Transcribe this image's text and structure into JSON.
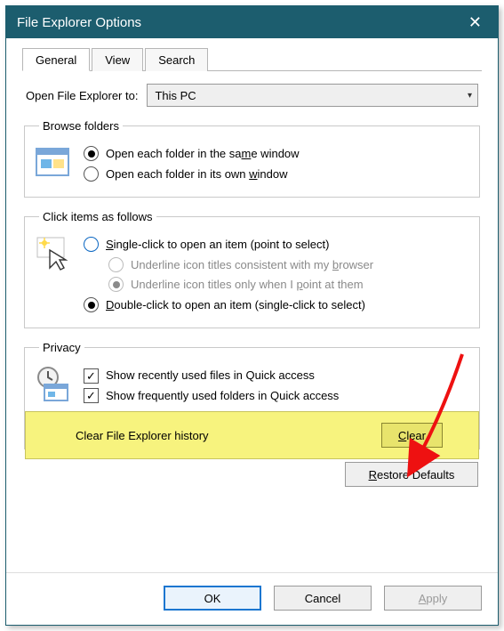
{
  "titlebar": {
    "title": "File Explorer Options"
  },
  "tabs": {
    "general": "General",
    "view": "View",
    "search": "Search"
  },
  "openExplorer": {
    "label": "Open File Explorer to:",
    "selected": "This PC"
  },
  "browseFolders": {
    "legend": "Browse folders",
    "sameWindow_pre": "Open each folder in the sa",
    "sameWindow_u": "m",
    "sameWindow_post": "e window",
    "ownWindow_pre": "Open each folder in its own ",
    "ownWindow_u": "w",
    "ownWindow_post": "indow"
  },
  "clickItems": {
    "legend": "Click items as follows",
    "single_u": "S",
    "single_post": "ingle-click to open an item (point to select)",
    "sub1_pre": "Underline icon titles consistent with my ",
    "sub1_u": "b",
    "sub1_post": "rowser",
    "sub2_pre": "Underline icon titles only when I ",
    "sub2_u": "p",
    "sub2_post": "oint at them",
    "double_u": "D",
    "double_post": "ouble-click to open an item (single-click to select)"
  },
  "privacy": {
    "legend": "Privacy",
    "recentFiles": "Show recently used files in Quick access",
    "frequentFolders": "Show frequently used folders in Quick access",
    "clearLabel": "Clear File Explorer history",
    "clearBtn_u": "C",
    "clearBtn_post": "lear"
  },
  "restore_u": "R",
  "restore_post": "estore Defaults",
  "buttons": {
    "ok": "OK",
    "cancel": "Cancel",
    "apply_u": "A",
    "apply_post": "pply"
  }
}
